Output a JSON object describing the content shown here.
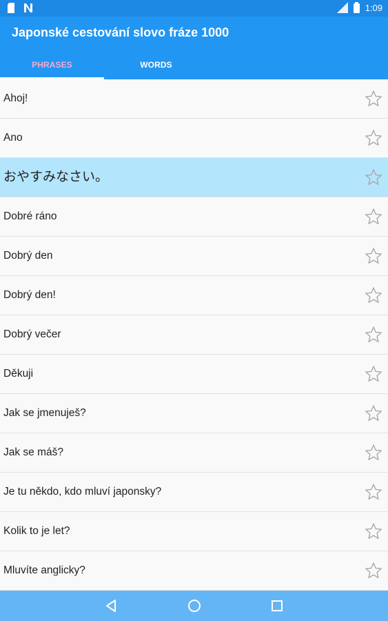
{
  "status_bar": {
    "time": "1:09"
  },
  "app_bar": {
    "title": "Japonské cestování slovo fráze 1000"
  },
  "tabs": [
    {
      "label": "PHRASES",
      "active": true
    },
    {
      "label": "WORDS",
      "active": false
    }
  ],
  "phrases": [
    {
      "text": "Ahoj!",
      "highlighted": false
    },
    {
      "text": "Ano",
      "highlighted": false
    },
    {
      "text": "おやすみなさい。",
      "highlighted": true
    },
    {
      "text": "Dobré ráno",
      "highlighted": false
    },
    {
      "text": "Dobrý den",
      "highlighted": false
    },
    {
      "text": "Dobrý den!",
      "highlighted": false
    },
    {
      "text": "Dobrý večer",
      "highlighted": false
    },
    {
      "text": "Děkuji",
      "highlighted": false
    },
    {
      "text": "Jak se jmenuješ?",
      "highlighted": false
    },
    {
      "text": "Jak se máš?",
      "highlighted": false
    },
    {
      "text": "Je tu někdo, kdo mluví japonsky?",
      "highlighted": false
    },
    {
      "text": "Kolik to je let?",
      "highlighted": false
    },
    {
      "text": "Mluvíte anglicky?",
      "highlighted": false
    }
  ],
  "icons": {
    "favorite": "star-outline-icon",
    "back": "back-triangle-icon",
    "home": "home-circle-icon",
    "recents": "recents-square-icon"
  },
  "colors": {
    "status_bar": "#1e88e5",
    "app_bar": "#2196f3",
    "active_tab_text": "#f4a9d2",
    "highlight_row": "#b3e5fc",
    "nav_bar": "#64b5f6"
  }
}
